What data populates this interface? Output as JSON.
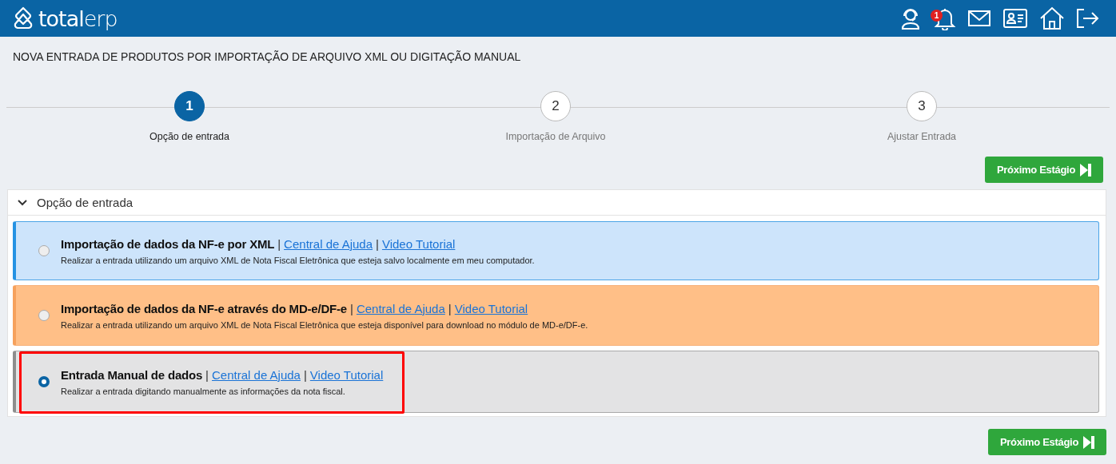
{
  "header": {
    "logo": "**total**erp",
    "notification_count": "1"
  },
  "page_title": "NOVA ENTRADA DE PRODUTOS POR IMPORTAÇÃO DE ARQUIVO XML OU DIGITAÇÃO MANUAL",
  "steps": [
    {
      "number": "1",
      "label": "Opção de entrada",
      "selected": true
    },
    {
      "number": "2",
      "label": "Importação de Arquivo",
      "selected": false
    },
    {
      "number": "3",
      "label": "Ajustar Entrada",
      "selected": false
    }
  ],
  "next_button_top": "Próximo Estágio",
  "panel": {
    "title": "Opção de entrada",
    "expanded": true,
    "options": [
      {
        "kind": "xml",
        "title": "Importação de dados da NF-e por XML",
        "links": [
          {
            "separator": "|",
            "label": "Central de Ajuda"
          },
          {
            "separator": "|",
            "label": "Video Tutorial"
          }
        ],
        "description": "Realizar a entrada utilizando um arquivo XML de Nota Fiscal Eletrônica que esteja salvo localmente em meu computador.",
        "selected": false,
        "highlighted": false
      },
      {
        "kind": "mde",
        "title": "Importação de dados da NF-e através do MD-e/DF-e",
        "links": [
          {
            "separator": "|",
            "label": "Central de Ajuda"
          },
          {
            "separator": "|",
            "label": "Video Tutorial"
          }
        ],
        "description": "Realizar a entrada utilizando um arquivo XML de Nota Fiscal Eletrônica que esteja disponível para download no módulo de MD-e/DF-e.",
        "selected": false,
        "highlighted": false
      },
      {
        "kind": "manual",
        "title": "Entrada Manual de dados",
        "links": [
          {
            "separator": "|",
            "label": "Central de Ajuda"
          },
          {
            "separator": "|",
            "label": "Video Tutorial"
          }
        ],
        "description": "Realizar a entrada digitando manualmente as informações da nota fiscal.",
        "selected": true,
        "highlighted": true
      }
    ]
  },
  "next_button_bottom": "Próximo Estágio"
}
